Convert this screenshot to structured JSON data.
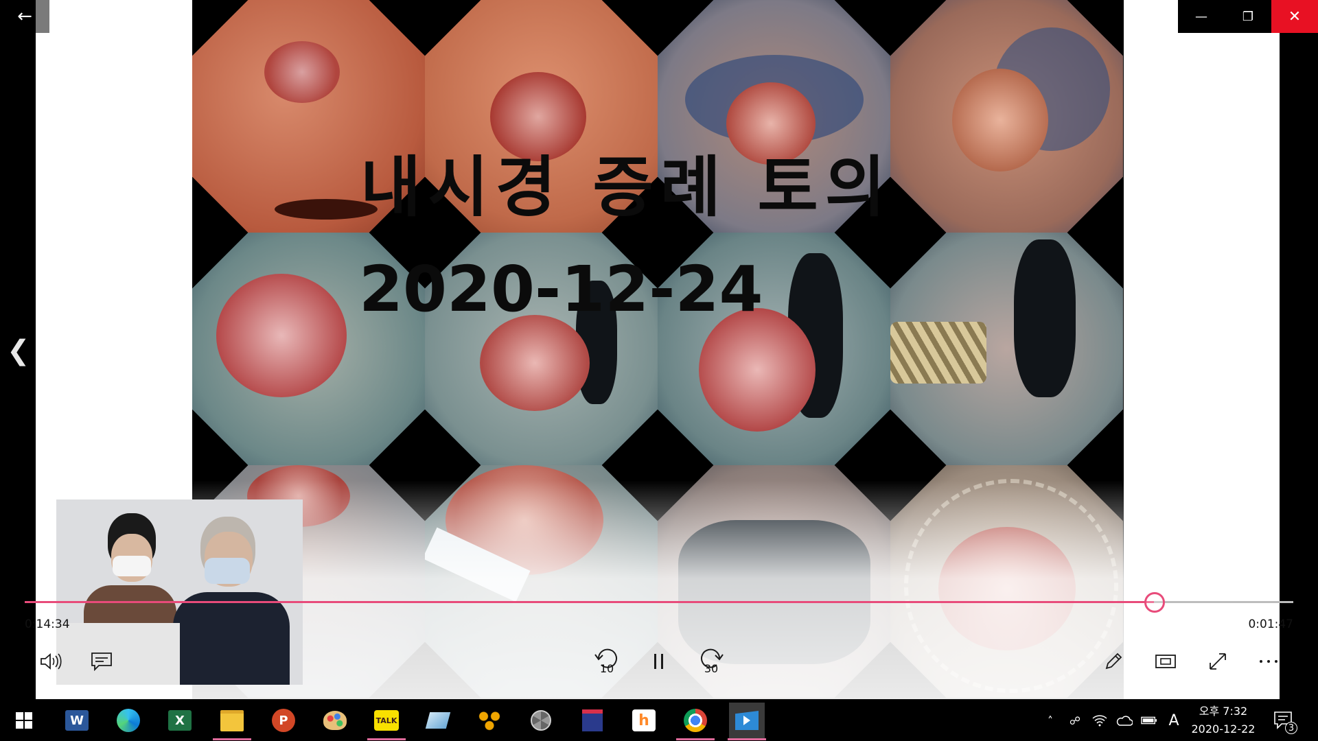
{
  "window": {
    "back_icon": "arrow-left-icon",
    "minimize": "—",
    "restore": "❐",
    "close": "✕"
  },
  "slide": {
    "title": "내시경 증례 토의",
    "date": "2020-12-24"
  },
  "player": {
    "elapsed": "0:14:34",
    "remaining": "0:01:47",
    "progress": 0.89,
    "skip_back_label": "10",
    "skip_forward_label": "30",
    "accent": "#e84b7a"
  },
  "taskbar": {
    "apps": [
      {
        "name": "Word",
        "letter": "W",
        "color": "#2b579a"
      },
      {
        "name": "Edge",
        "color": "#0c7bd6"
      },
      {
        "name": "Excel",
        "letter": "X",
        "color": "#1f7244"
      },
      {
        "name": "File Explorer",
        "color": "#f3c53c"
      },
      {
        "name": "PowerPoint",
        "letter": "P",
        "color": "#d24726"
      },
      {
        "name": "Paint",
        "color": "#e8a33a"
      },
      {
        "name": "KakaoTalk",
        "letter": "TALK",
        "color": "#f9e000"
      },
      {
        "name": "App",
        "color": "#9ec9e8"
      },
      {
        "name": "App2",
        "color": "#f0a500"
      },
      {
        "name": "Aperture",
        "color": "#cccccc"
      },
      {
        "name": "Calendar app",
        "color": "#2a3a8c"
      },
      {
        "name": "Hangul",
        "letter": "h",
        "color": "#ff8a2a"
      },
      {
        "name": "Chrome",
        "color": "#db4437"
      },
      {
        "name": "Movies & TV",
        "color": "#2d8ad6"
      }
    ],
    "clock_period": "오후 7:32",
    "clock_date": "2020-12-22",
    "ime": "A",
    "notification_count": "3"
  }
}
